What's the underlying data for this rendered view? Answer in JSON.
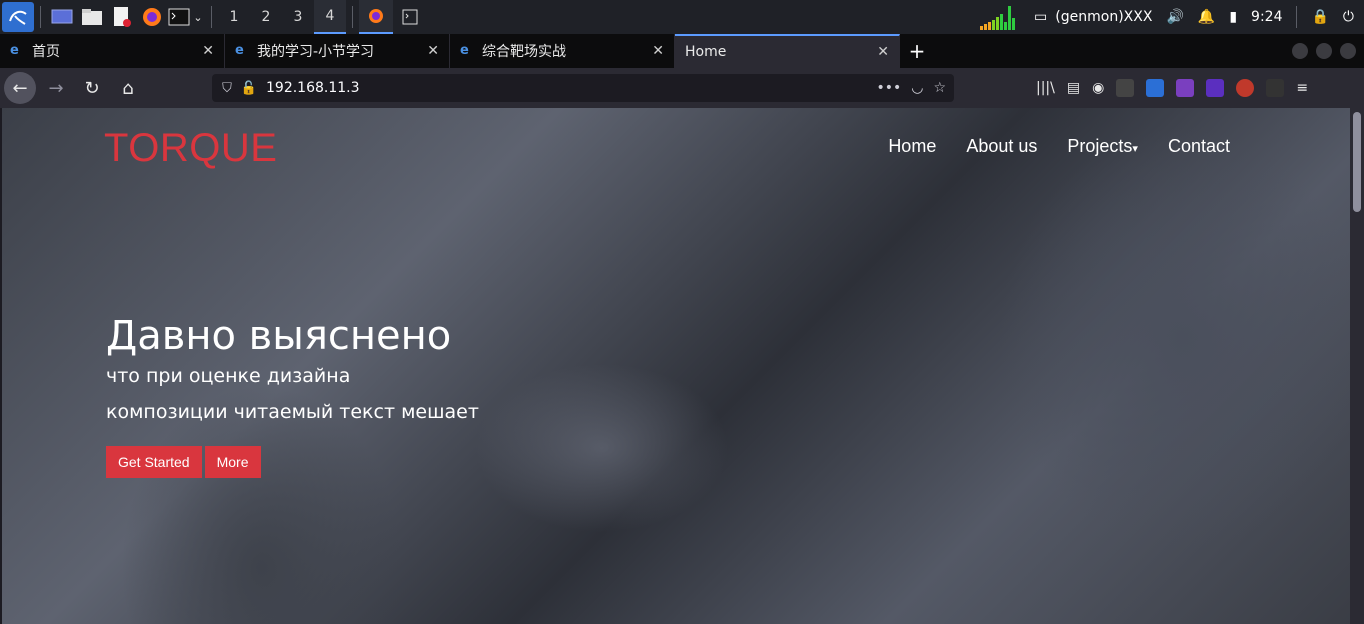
{
  "taskbar": {
    "workspaces": [
      "1",
      "2",
      "3",
      "4"
    ],
    "genmon": "(genmon)XXX",
    "clock": "9:24"
  },
  "browser": {
    "tabs": [
      {
        "label": "首页",
        "close": "✕"
      },
      {
        "label": "我的学习-小节学习",
        "close": "✕"
      },
      {
        "label": "综合靶场实战",
        "close": "✕"
      },
      {
        "label": "Home",
        "close": "✕"
      }
    ],
    "new_tab": "+",
    "url": "192.168.11.3",
    "url_more": "•••"
  },
  "page": {
    "brand": "TORQUE",
    "nav": [
      "Home",
      "About us",
      "Projects",
      "Contact"
    ],
    "hero": {
      "title": "Давно выяснено",
      "line1": "что при оценке дизайна",
      "line2": "композиции читаемый текст мешает",
      "btn_primary": "Get Started",
      "btn_secondary": "More"
    }
  },
  "colors": {
    "accent": "#d9363e",
    "tab_active_border": "#5c9bff"
  }
}
